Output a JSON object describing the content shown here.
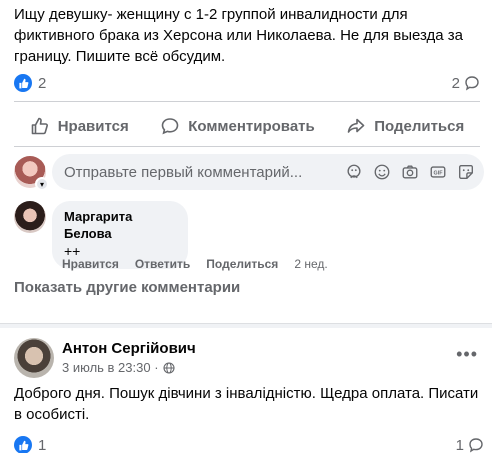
{
  "post1": {
    "text": "Ищу девушку- женщину с 1-2 группой инвалидности  для фиктивного брака из Херсона или Николаева. Не для выезда за границу. Пишите всё обсудим.",
    "likes": "2",
    "comments_count": "2"
  },
  "actions": {
    "like": "Нравится",
    "comment": "Комментировать",
    "share": "Поделиться"
  },
  "composer": {
    "placeholder": "Отправьте первый комментарий..."
  },
  "comment": {
    "author": "Маргарита Белова",
    "text": "++",
    "like": "Нравится",
    "reply": "Ответить",
    "share": "Поделиться",
    "time": "2 нед."
  },
  "more_comments": "Показать другие комментарии",
  "post2": {
    "author": "Антон Сергійович",
    "date": "3 июль в 23:30 ·",
    "text": "Доброго дня. Пошук дівчини з інвалідністю. Щедра оплата. Писати в особисті.",
    "likes": "1",
    "comments_count": "1"
  },
  "colors": {
    "accent": "#1877f2",
    "secondary_text": "#65676b",
    "bubble": "#f0f2f5"
  }
}
